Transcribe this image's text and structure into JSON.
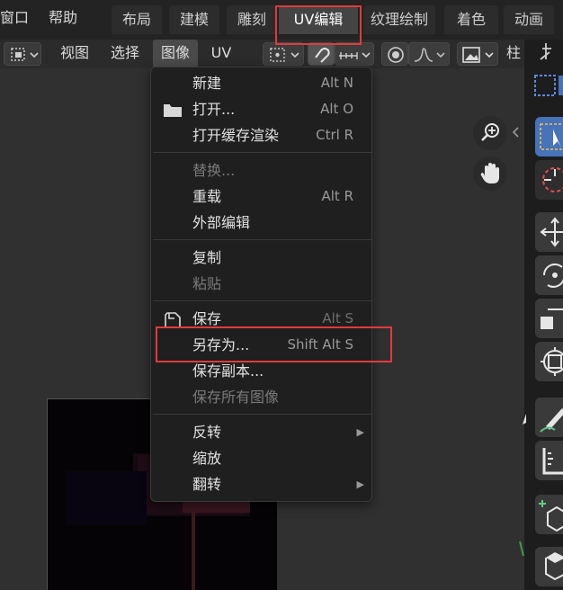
{
  "topbar": {
    "menus": [
      "窗口",
      "帮助"
    ],
    "workspaces": [
      "布局",
      "建模",
      "雕刻",
      "UV编辑",
      "纹理绘制",
      "着色",
      "动画"
    ],
    "active_workspace": "UV编辑"
  },
  "header": {
    "menus": [
      "视图",
      "选择",
      "图像",
      "UV"
    ],
    "open_menu": "图像",
    "truncated_label": "柱"
  },
  "image_menu": {
    "groups": [
      [
        {
          "label": "新建",
          "shortcut": "Alt N",
          "icon": ""
        },
        {
          "label": "打开...",
          "shortcut": "Alt O",
          "icon": "folder-icon"
        },
        {
          "label": "打开缓存渲染",
          "shortcut": "Ctrl R",
          "icon": ""
        }
      ],
      [
        {
          "label": "替换...",
          "shortcut": "",
          "disabled": true
        },
        {
          "label": "重载",
          "shortcut": "Alt R"
        },
        {
          "label": "外部编辑",
          "shortcut": ""
        }
      ],
      [
        {
          "label": "复制",
          "shortcut": ""
        },
        {
          "label": "粘贴",
          "shortcut": "",
          "disabled": true
        }
      ],
      [
        {
          "label": "保存",
          "shortcut": "Alt S",
          "icon": "save-icon",
          "disabled_shortcut": true
        },
        {
          "label": "另存为...",
          "shortcut": "Shift Alt S",
          "highlighted": true
        },
        {
          "label": "保存副本...",
          "shortcut": ""
        },
        {
          "label": "保存所有图像",
          "shortcut": "",
          "disabled": true
        }
      ],
      [
        {
          "label": "反转",
          "shortcut": "",
          "submenu": true
        },
        {
          "label": "缩放",
          "shortcut": ""
        },
        {
          "label": "翻转",
          "shortcut": "",
          "submenu": true
        }
      ]
    ]
  },
  "colors": {
    "accent": "#4773b8",
    "highlight_box": "#e03b3b",
    "menu_bg": "#1f1f1f"
  }
}
